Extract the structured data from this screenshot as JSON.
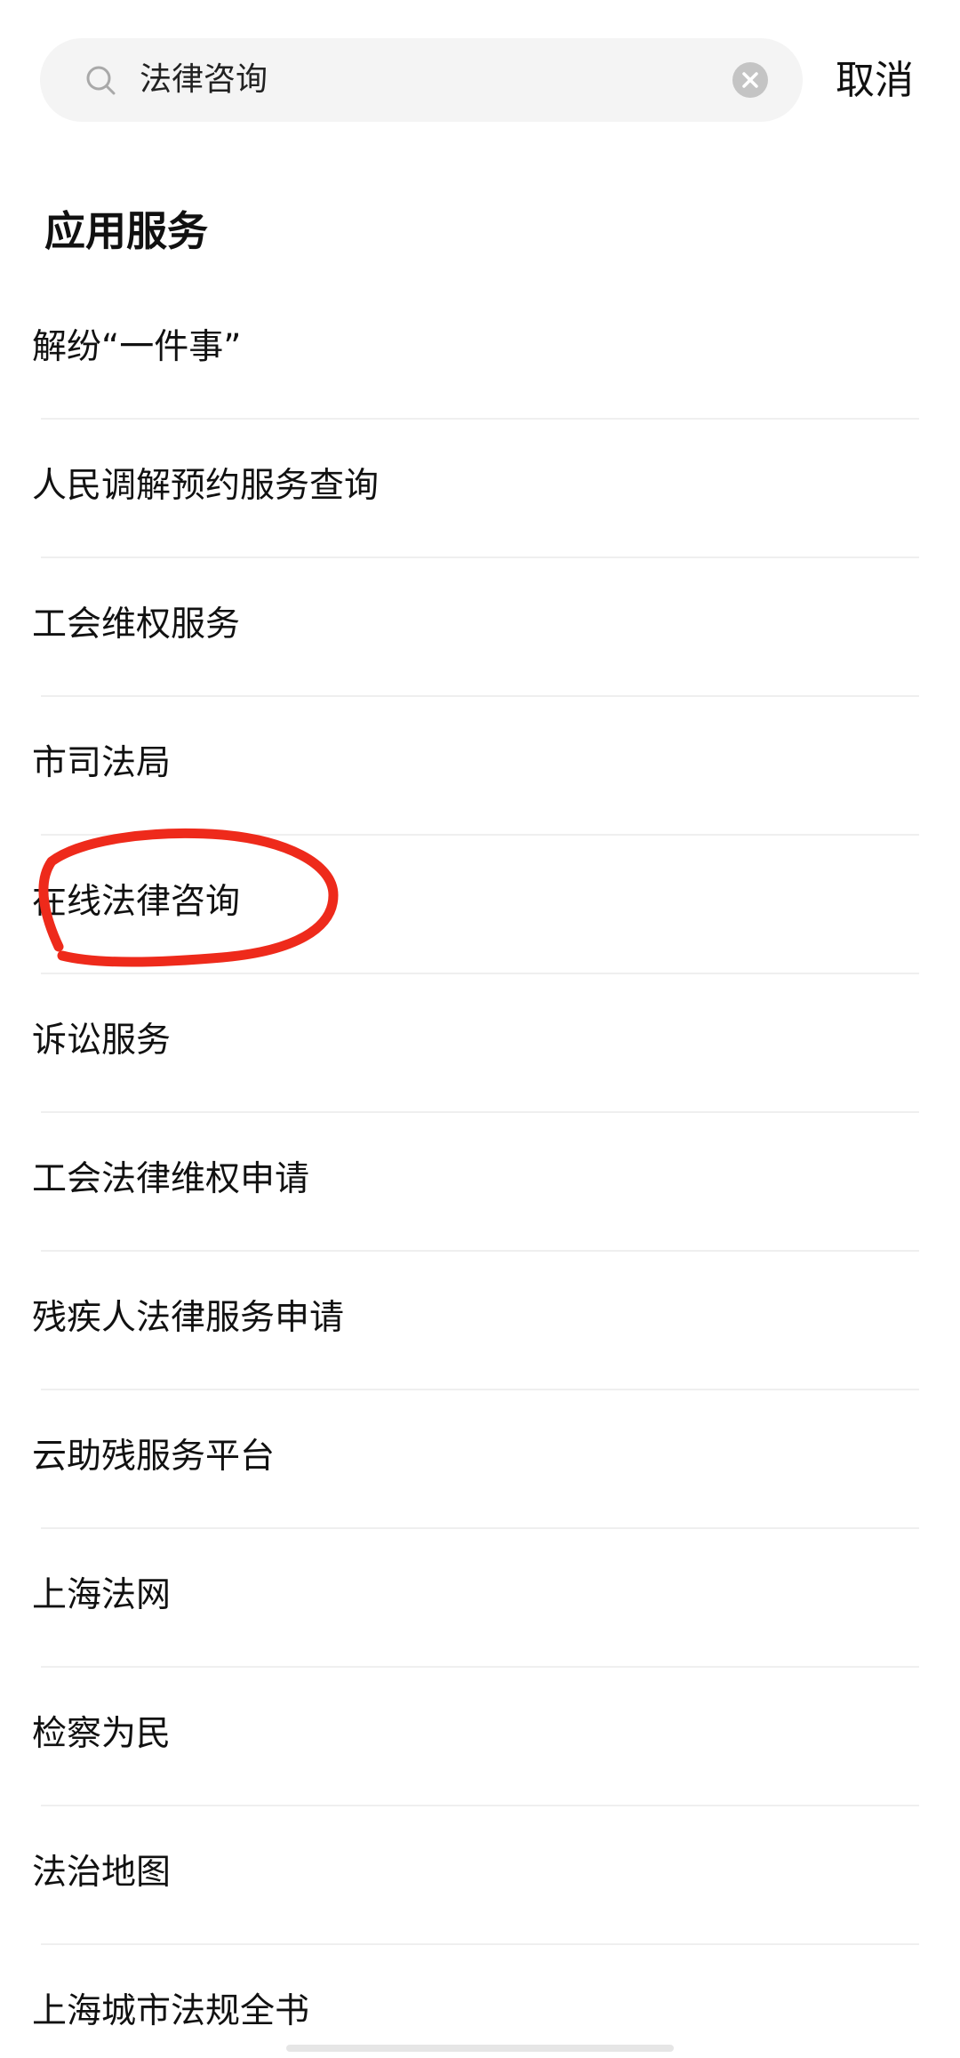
{
  "search": {
    "value": "法律咨询",
    "cancel_label": "取消"
  },
  "section": {
    "title": "应用服务"
  },
  "results": [
    {
      "label": "解纷“一件事”"
    },
    {
      "label": "人民调解预约服务查询"
    },
    {
      "label": "工会维权服务"
    },
    {
      "label": "市司法局"
    },
    {
      "label": "在线法律咨询"
    },
    {
      "label": "诉讼服务"
    },
    {
      "label": "工会法律维权申请"
    },
    {
      "label": "残疾人法律服务申请"
    },
    {
      "label": "云助残服务平台"
    },
    {
      "label": "上海法网"
    },
    {
      "label": "检察为民"
    },
    {
      "label": "法治地图"
    },
    {
      "label": "上海城市法规全书"
    }
  ],
  "icons": {
    "search": "search-icon",
    "clear": "clear-icon"
  },
  "colors": {
    "annotation": "#ee2a1b",
    "search_bg": "#f4f4f4",
    "divider": "#efefef"
  }
}
